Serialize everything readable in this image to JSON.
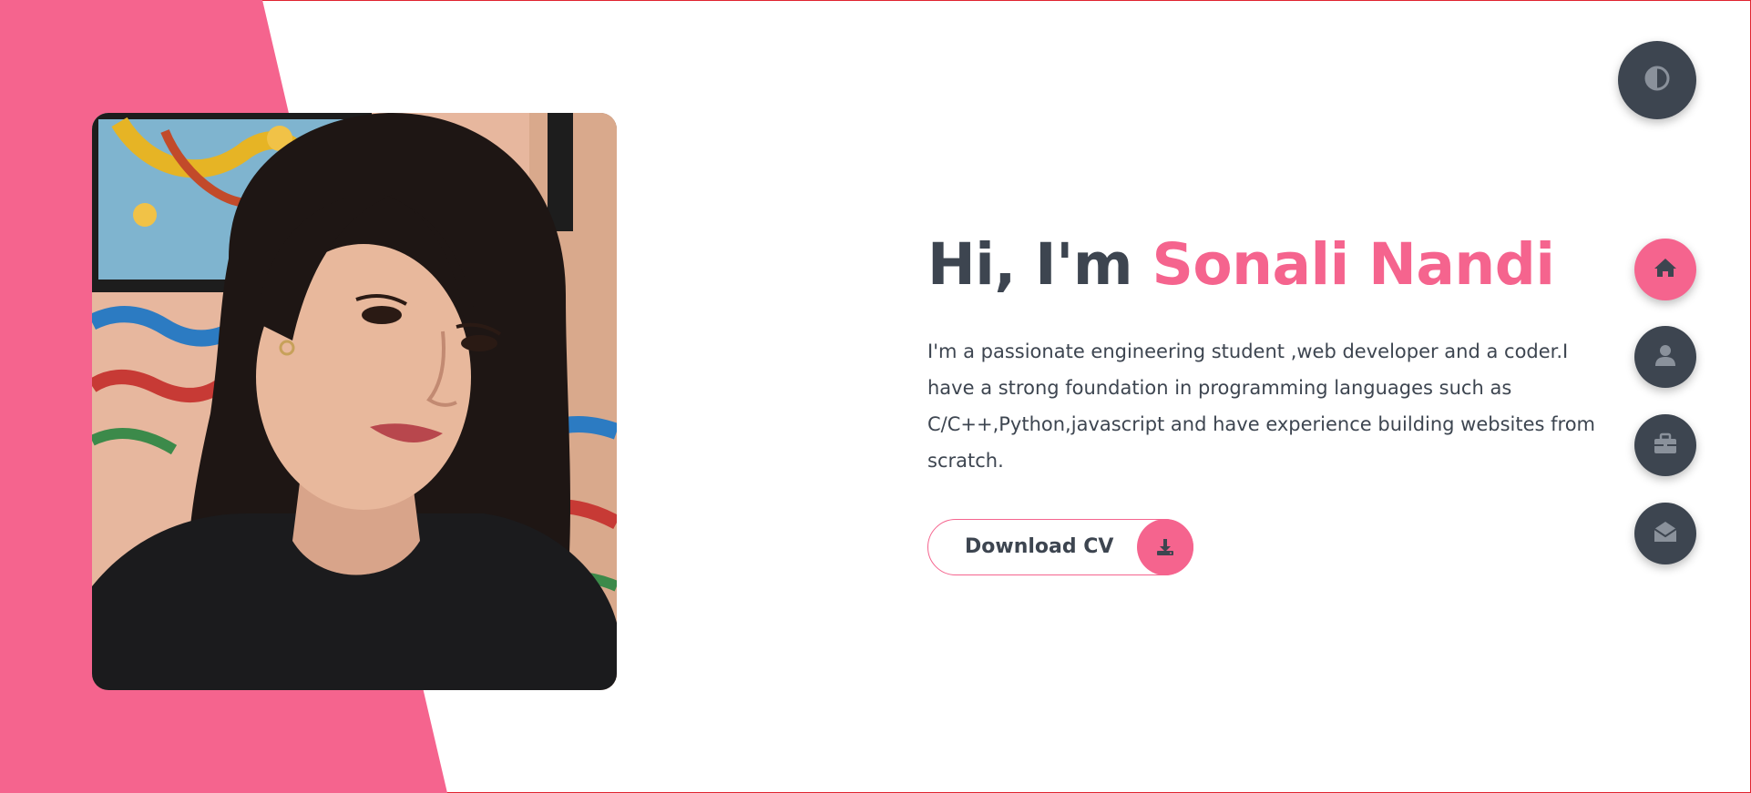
{
  "hero": {
    "greeting": "Hi, I'm",
    "name": "Sonali Nandi",
    "description": "I'm a passionate engineering student ,web developer and a coder.I have a strong foundation in programming languages such as C/C++,Python,javascript and have experience building websites from scratch."
  },
  "cv_button": {
    "label": "Download CV",
    "icon": "download-icon"
  },
  "theme_toggle": {
    "icon": "contrast-icon"
  },
  "nav": [
    {
      "icon": "home-icon",
      "active": true
    },
    {
      "icon": "user-icon",
      "active": false
    },
    {
      "icon": "briefcase-icon",
      "active": false
    },
    {
      "icon": "envelope-open-icon",
      "active": false
    }
  ],
  "colors": {
    "accent": "#f5648e",
    "dark": "#3d4550",
    "background": "#ffffff"
  }
}
